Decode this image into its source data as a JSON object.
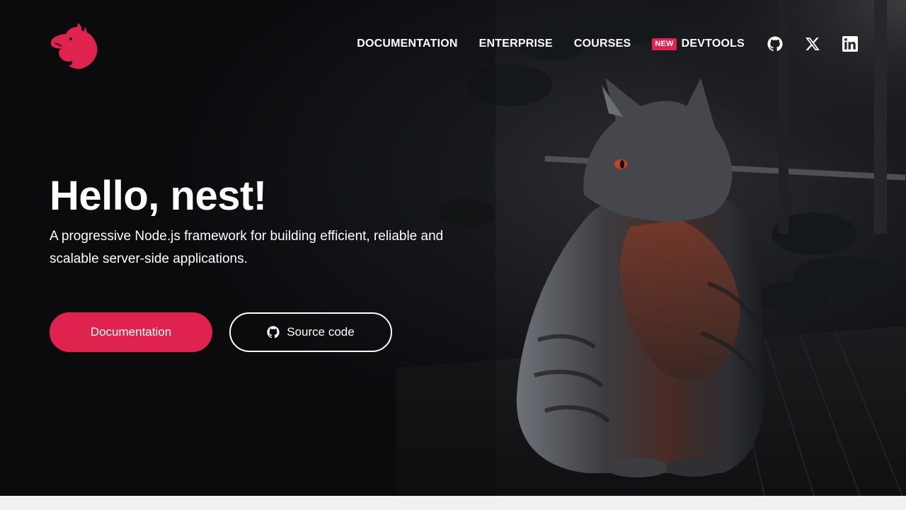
{
  "brand": {
    "name": "NestJS",
    "accent_color": "#e0234e",
    "logo_icon": "nest-cat-logo-icon"
  },
  "nav": {
    "links": [
      {
        "label": "DOCUMENTATION"
      },
      {
        "label": "ENTERPRISE"
      },
      {
        "label": "COURSES"
      },
      {
        "label": "DEVTOOLS",
        "badge": "NEW"
      }
    ],
    "social": [
      {
        "icon": "github-icon"
      },
      {
        "icon": "x-twitter-icon"
      },
      {
        "icon": "linkedin-icon"
      }
    ]
  },
  "hero": {
    "title": "Hello, nest!",
    "subtitle": "A progressive Node.js framework for building efficient, reliable and scalable server-side applications.",
    "primary_button": "Documentation",
    "secondary_button": "Source code",
    "secondary_button_icon": "github-icon",
    "background": "dark photo of a cat sitting on a wooden porch"
  }
}
